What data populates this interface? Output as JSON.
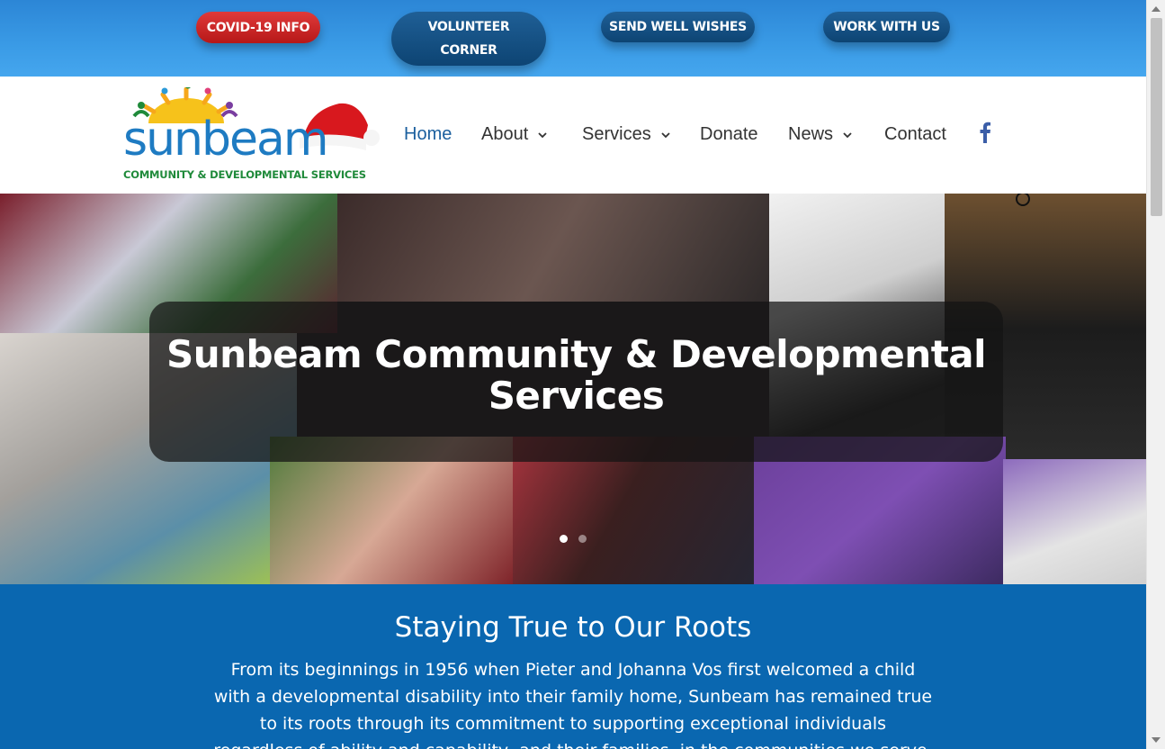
{
  "topbar": {
    "buttons": [
      {
        "label": "COVID-19 INFO"
      },
      {
        "label_line1": "VOLUNTEER",
        "label_line2": "CORNER"
      },
      {
        "label": "SEND WELL WISHES"
      },
      {
        "label": "WORK WITH US"
      }
    ]
  },
  "logo": {
    "word": "sunbeam",
    "tagline": "COMMUNITY & DEVELOPMENTAL SERVICES"
  },
  "nav": {
    "items": [
      {
        "label": "Home",
        "active": true
      },
      {
        "label": "About",
        "dropdown": true
      },
      {
        "label": "Services",
        "dropdown": true
      },
      {
        "label": "Donate"
      },
      {
        "label": "News",
        "dropdown": true
      },
      {
        "label": "Contact"
      }
    ],
    "social_icon": "facebook-icon"
  },
  "hero": {
    "title": "Sunbeam Community & Developmental Services",
    "slides": 2,
    "active_slide": 1
  },
  "about": {
    "heading": "Staying True to Our Roots",
    "body": "From its beginnings in 1956 when Pieter and Johanna Vos first welcomed a child with a developmental disability into their family home, Sunbeam has remained true to its roots through its commitment to supporting exceptional individuals regardless of ability and capability, and their families, in the communities we serve."
  },
  "colors": {
    "topbar": "#3a9be6",
    "red_pill": "#c42020",
    "blue_pill": "#134f82",
    "nav_active": "#1b5f9e",
    "about_bg": "#0a67b0"
  }
}
